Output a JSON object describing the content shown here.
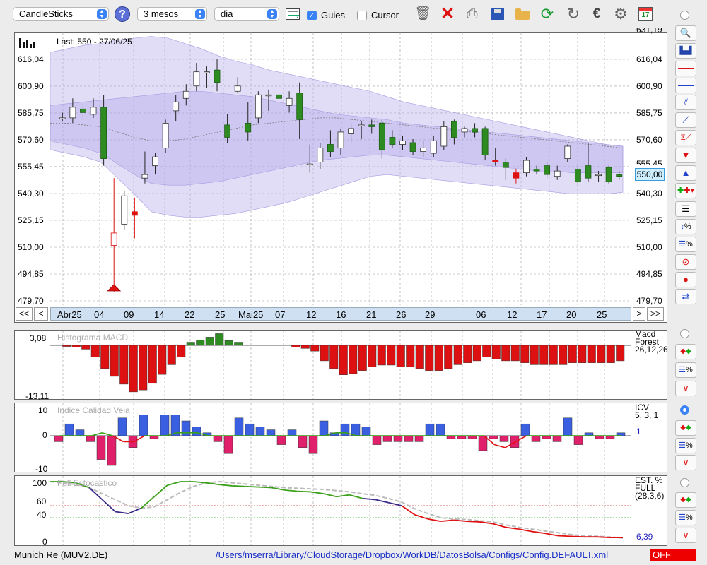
{
  "toolbar": {
    "chart_type": "CandleSticks",
    "period": "3 mesos",
    "interval": "dia",
    "guies_label": "Guies",
    "guies_checked": true,
    "cursor_label": "Cursor",
    "cursor_checked": false,
    "icons": [
      "trash-icon",
      "close-icon",
      "print-icon",
      "save-icon",
      "folder-icon",
      "refresh-icon",
      "sync-icon",
      "euro-icon",
      "gear-icon",
      "calendar-icon"
    ],
    "calendar_day": "17"
  },
  "main_chart": {
    "last_label": "Last: 550 - 27/06/25",
    "price_badge": "550,00",
    "top_partial_label": "631,19"
  },
  "nav": {
    "first": "<<",
    "prev": "<",
    "next": ">",
    "last": ">>"
  },
  "macd": {
    "title": "Histograma MACD",
    "name": "Macd",
    "sub": "Forest",
    "params": "26,12,26",
    "ymax": "3,08",
    "ymin": "-13,11"
  },
  "icv": {
    "title": "Indice Calidad Vela",
    "name": "ICV",
    "params": "5, 3, 1",
    "value": "1",
    "ymax": "10",
    "ymid": "0",
    "ymin": "-10"
  },
  "stoch": {
    "title": "Full Estocastico",
    "name": "EST. %",
    "sub": "FULL",
    "params": "(28,3,6)",
    "value": "6,39",
    "y100": "100",
    "y60": "60",
    "y40": "40",
    "y0": "0"
  },
  "footer": {
    "symbol": "Munich Re (MUV2.DE)",
    "path": "/Users/mserra/Library/CloudStorage/Dropbox/WorkDB/DatosBolsa/Configs/Config.DEFAULT.xml",
    "status": "OFF"
  },
  "colors": {
    "up": "#2e8b22",
    "down": "#dd1111",
    "band": "#c9c2f0",
    "macd_pos": "#2e8b22",
    "macd_neg": "#dd1111",
    "icv_pos": "#3a5fe0",
    "icv_neg": "#e0206a",
    "stoch_green": "#3aa018",
    "stoch_red": "#e01010",
    "stoch_navy": "#3a2a8a"
  },
  "chart_data": {
    "type": "candlestick",
    "title": "",
    "ylim": [
      479.7,
      631.19
    ],
    "y_ticks": [
      "616,04",
      "600,90",
      "585,75",
      "570,60",
      "555,45",
      "540,30",
      "525,15",
      "510,00",
      "494,85",
      "479,70"
    ],
    "x_labels": [
      "Abr25",
      "04",
      "09",
      "14",
      "22",
      "25",
      "Mai25",
      "07",
      "12",
      "16",
      "21",
      "26",
      "29",
      "06",
      "12",
      "17",
      "20",
      "25"
    ],
    "candles": [
      {
        "o": 583,
        "c": 583,
        "h": 586,
        "l": 581,
        "up": false
      },
      {
        "o": 583,
        "c": 589,
        "h": 594,
        "l": 580,
        "up": true
      },
      {
        "o": 588,
        "c": 586,
        "h": 591,
        "l": 583,
        "up": true
      },
      {
        "o": 585,
        "c": 589,
        "h": 594,
        "l": 583,
        "up": true
      },
      {
        "o": 589,
        "c": 560,
        "h": 596,
        "l": 556,
        "up": false
      },
      {
        "o": 518,
        "c": 511,
        "h": 549,
        "l": 485,
        "up": false
      },
      {
        "o": 523,
        "c": 539,
        "h": 542,
        "l": 520,
        "up": true
      },
      {
        "o": 530,
        "c": 528,
        "h": 538,
        "l": 515,
        "up": false
      },
      {
        "o": 549,
        "c": 551,
        "h": 564,
        "l": 546,
        "up": false
      },
      {
        "o": 556,
        "c": 561,
        "h": 563,
        "l": 551,
        "up": false
      },
      {
        "o": 566,
        "c": 580,
        "h": 582,
        "l": 563,
        "up": true
      },
      {
        "o": 587,
        "c": 592,
        "h": 596,
        "l": 581,
        "up": true
      },
      {
        "o": 594,
        "c": 598,
        "h": 602,
        "l": 590,
        "up": true
      },
      {
        "o": 601,
        "c": 609,
        "h": 614,
        "l": 598,
        "up": true
      },
      {
        "o": 609,
        "c": 609,
        "h": 612,
        "l": 600,
        "up": false
      },
      {
        "o": 610,
        "c": 603,
        "h": 616,
        "l": 598,
        "up": false
      },
      {
        "o": 579,
        "c": 572,
        "h": 585,
        "l": 569,
        "up": false
      },
      {
        "o": 598,
        "c": 601,
        "h": 606,
        "l": 597,
        "up": true
      },
      {
        "o": 580,
        "c": 575,
        "h": 592,
        "l": 570,
        "up": false
      },
      {
        "o": 583,
        "c": 596,
        "h": 598,
        "l": 580,
        "up": true
      },
      {
        "o": 596,
        "c": 596,
        "h": 599,
        "l": 587,
        "up": false
      },
      {
        "o": 596,
        "c": 594,
        "h": 597,
        "l": 585,
        "up": false
      },
      {
        "o": 590,
        "c": 594,
        "h": 598,
        "l": 586,
        "up": true
      },
      {
        "o": 597,
        "c": 582,
        "h": 603,
        "l": 571,
        "up": false
      },
      {
        "o": 557,
        "c": 557,
        "h": 568,
        "l": 552,
        "up": false
      },
      {
        "o": 558,
        "c": 566,
        "h": 569,
        "l": 554,
        "up": true
      },
      {
        "o": 568,
        "c": 564,
        "h": 576,
        "l": 561,
        "up": false
      },
      {
        "o": 566,
        "c": 575,
        "h": 577,
        "l": 562,
        "up": true
      },
      {
        "o": 574,
        "c": 577,
        "h": 580,
        "l": 569,
        "up": true
      },
      {
        "o": 579,
        "c": 579,
        "h": 581,
        "l": 571,
        "up": false
      },
      {
        "o": 579,
        "c": 578,
        "h": 582,
        "l": 574,
        "up": false
      },
      {
        "o": 580,
        "c": 565,
        "h": 582,
        "l": 560,
        "up": false
      },
      {
        "o": 572,
        "c": 568,
        "h": 576,
        "l": 566,
        "up": false
      },
      {
        "o": 568,
        "c": 570,
        "h": 573,
        "l": 565,
        "up": true
      },
      {
        "o": 569,
        "c": 564,
        "h": 571,
        "l": 562,
        "up": false
      },
      {
        "o": 564,
        "c": 566,
        "h": 570,
        "l": 561,
        "up": false
      },
      {
        "o": 563,
        "c": 570,
        "h": 573,
        "l": 561,
        "up": true
      },
      {
        "o": 567,
        "c": 578,
        "h": 581,
        "l": 565,
        "up": true
      },
      {
        "o": 581,
        "c": 572,
        "h": 582,
        "l": 568,
        "up": false
      },
      {
        "o": 575,
        "c": 577,
        "h": 578,
        "l": 572,
        "up": true
      },
      {
        "o": 577,
        "c": 575,
        "h": 580,
        "l": 572,
        "up": true
      },
      {
        "o": 577,
        "c": 562,
        "h": 578,
        "l": 559,
        "up": false
      },
      {
        "o": 558,
        "c": 559,
        "h": 566,
        "l": 556,
        "up": false
      },
      {
        "o": 558,
        "c": 555,
        "h": 560,
        "l": 548,
        "up": false
      },
      {
        "o": 552,
        "c": 549,
        "h": 554,
        "l": 546,
        "up": false
      },
      {
        "o": 552,
        "c": 559,
        "h": 561,
        "l": 550,
        "up": true
      },
      {
        "o": 554,
        "c": 553,
        "h": 556,
        "l": 551,
        "up": false
      },
      {
        "o": 556,
        "c": 551,
        "h": 558,
        "l": 549,
        "up": false
      },
      {
        "o": 550,
        "c": 553,
        "h": 556,
        "l": 548,
        "up": true
      },
      {
        "o": 560,
        "c": 567,
        "h": 568,
        "l": 558,
        "up": true
      },
      {
        "o": 554,
        "c": 547,
        "h": 556,
        "l": 545,
        "up": false
      },
      {
        "o": 556,
        "c": 549,
        "h": 569,
        "l": 547,
        "up": false
      },
      {
        "o": 551,
        "c": 551,
        "h": 553,
        "l": 547,
        "up": false
      },
      {
        "o": 555,
        "c": 547,
        "h": 556,
        "l": 546,
        "up": false
      },
      {
        "o": 551,
        "c": 550,
        "h": 553,
        "l": 548,
        "up": false
      }
    ],
    "band_upper": [
      620,
      622,
      624,
      625,
      627,
      628,
      629,
      628,
      625,
      622,
      618,
      615,
      613,
      610,
      608,
      606,
      604,
      602,
      600,
      598,
      595,
      592,
      590,
      588,
      586,
      584,
      582,
      580,
      578,
      576,
      574,
      572,
      570,
      568,
      567
    ],
    "band_lower": [
      565,
      563,
      561,
      558,
      549,
      540,
      530,
      528,
      527,
      527,
      528,
      529,
      531,
      533,
      535,
      538,
      541,
      544,
      547,
      550,
      551,
      550,
      549,
      548,
      547,
      546,
      545,
      544,
      543,
      542,
      541,
      540,
      540,
      540,
      541
    ],
    "band_inner_upper": [
      590,
      591,
      592,
      593,
      594,
      595,
      596,
      597,
      598,
      598,
      597,
      596,
      595,
      593,
      591,
      589,
      587,
      585,
      584,
      583,
      582,
      580,
      579,
      578,
      577,
      576,
      575,
      574,
      573,
      572,
      571,
      570,
      569,
      568,
      567
    ],
    "band_inner_lower": [
      570,
      568,
      566,
      563,
      557,
      551,
      546,
      545,
      545,
      546,
      547,
      549,
      551,
      553,
      555,
      557,
      559,
      560,
      561,
      562,
      562,
      561,
      560,
      559,
      558,
      557,
      556,
      555,
      554,
      553,
      553,
      552,
      552,
      552,
      552
    ],
    "midline": [
      580,
      580,
      579,
      578,
      575,
      572,
      570,
      570,
      571,
      573,
      575,
      577,
      579,
      580,
      581,
      582,
      583,
      583,
      582,
      581,
      580,
      579,
      578,
      577,
      576,
      575,
      574,
      573,
      572,
      571,
      570,
      569,
      568,
      567,
      566
    ],
    "macd_hist": [
      0,
      -0.3,
      -0.5,
      -1,
      -3,
      -6,
      -8,
      -10,
      -12,
      -11.5,
      -9.8,
      -7.5,
      -5,
      -3,
      0.8,
      1.4,
      2.1,
      3.0,
      1.2,
      0.8,
      0,
      0,
      0,
      0,
      0,
      -0.5,
      -0.8,
      -1.5,
      -4,
      -6,
      -7.6,
      -7.3,
      -6.5,
      -5.5,
      -5.1,
      -5.1,
      -5.5,
      -5.5,
      -6,
      -6.5,
      -6.5,
      -6,
      -5,
      -4.5,
      -4,
      -3,
      -3.5,
      -4,
      -4,
      -4.5,
      -5,
      -5,
      -5,
      -5,
      -4.5,
      -4.5,
      -4.5,
      -4.5,
      -4.5,
      -4
    ]
  },
  "icv_data": {
    "bars": [
      -2,
      4,
      2,
      -2,
      -8,
      -10,
      6,
      -4,
      7,
      -1,
      7,
      7,
      5,
      3,
      1,
      -2,
      -6,
      6,
      4,
      3,
      2,
      -3,
      2,
      -4,
      -6,
      5,
      1,
      4,
      4,
      3,
      -3,
      -2,
      -2,
      -2,
      -2,
      4,
      4,
      -1,
      -1,
      -1,
      -5,
      -1,
      -2,
      -4,
      4,
      -2,
      -1,
      -2,
      6,
      -3,
      1,
      -1,
      -1,
      1
    ],
    "line": [
      0,
      0,
      0,
      0,
      1,
      0,
      -2,
      -2,
      0,
      0,
      0,
      1,
      1,
      1,
      0,
      0,
      0,
      0,
      0,
      0,
      0,
      0,
      0,
      0,
      0,
      0,
      1,
      1,
      0,
      0,
      0,
      0,
      0,
      0,
      0,
      0,
      0,
      0,
      0,
      0,
      0,
      -3,
      -4,
      -2,
      0,
      0,
      0,
      0,
      0,
      0,
      0,
      0,
      0,
      0
    ]
  },
  "stoch_data": {
    "k": [
      100,
      100,
      98,
      90,
      70,
      50,
      47,
      56,
      75,
      94,
      100,
      100,
      98,
      95,
      93,
      92,
      91,
      90,
      86,
      84,
      83,
      80,
      75,
      78,
      72,
      70,
      65,
      60,
      45,
      38,
      34,
      36,
      34,
      33,
      30,
      24,
      21,
      17,
      14,
      10,
      9,
      8,
      8,
      7,
      7
    ],
    "d": [
      100,
      98,
      95,
      90,
      80,
      70,
      60,
      56,
      58,
      70,
      82,
      92,
      98,
      100,
      98,
      96,
      94,
      92,
      90,
      89,
      88,
      87,
      85,
      83,
      80,
      77,
      72,
      66,
      55,
      47,
      40,
      38,
      37,
      35,
      33,
      28,
      24,
      21,
      18,
      15,
      12,
      10,
      9,
      8,
      6
    ]
  }
}
